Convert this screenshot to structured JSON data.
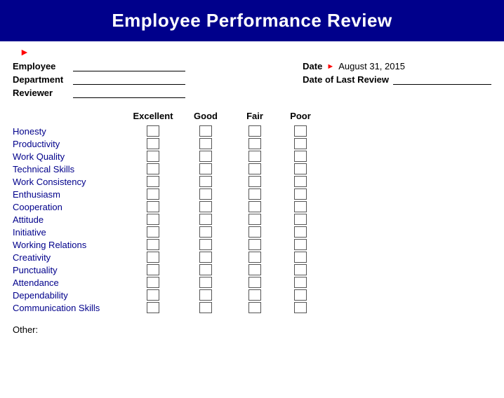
{
  "header": {
    "title": "Employee Performance Review"
  },
  "form": {
    "employee_label": "Employee",
    "department_label": "Department",
    "reviewer_label": "Reviewer",
    "date_label": "Date",
    "date_value": "August 31, 2015",
    "last_review_label": "Date of Last Review"
  },
  "ratings": {
    "columns": [
      "Excellent",
      "Good",
      "Fair",
      "Poor"
    ],
    "skills": [
      "Honesty",
      "Productivity",
      "Work Quality",
      "Technical Skills",
      "Work Consistency",
      "Enthusiasm",
      "Cooperation",
      "Attitude",
      "Initiative",
      "Working Relations",
      "Creativity",
      "Punctuality",
      "Attendance",
      "Dependability",
      "Communication Skills"
    ]
  },
  "other": {
    "label": "Other:"
  }
}
